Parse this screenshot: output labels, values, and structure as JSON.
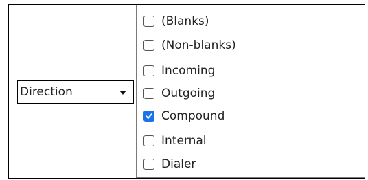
{
  "filter": {
    "field_label": "Direction",
    "options": [
      {
        "label": "(Blanks)",
        "checked": false
      },
      {
        "label": "(Non-blanks)",
        "checked": false
      },
      {
        "label": "Incoming",
        "checked": false
      },
      {
        "label": "Outgoing",
        "checked": false
      },
      {
        "label": "Compound",
        "checked": true
      },
      {
        "label": "Internal",
        "checked": false
      },
      {
        "label": "Dialer",
        "checked": false
      }
    ]
  },
  "colors": {
    "checked": "#1a73e8",
    "border": "#000000",
    "panel_border": "#7a7a7a"
  }
}
